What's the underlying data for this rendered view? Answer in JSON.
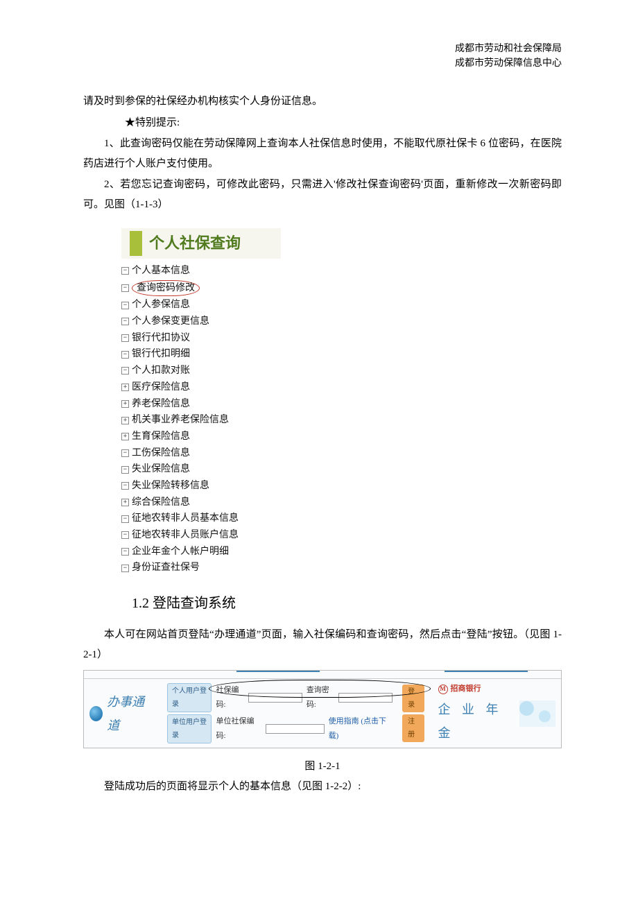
{
  "header": {
    "line1": "成都市劳动和社会保障局",
    "line2": "成都市劳动保障信息中心"
  },
  "body": {
    "p0": "请及时到参保的社保经办机构核实个人身份证信息。",
    "p1": "★特别提示:",
    "p2": "1、此查询密码仅能在劳动保障网上查询本人社保信息时使用，不能取代原社保卡 6 位密码，在医院药店进行个人账户支付使用。",
    "p3": "2、若您忘记查询密码，可修改此密码，只需进入'修改社保查询密码'页面，重新修改一次新密码即可。见图（1-1-3）"
  },
  "menu": {
    "title": "个人社保查询",
    "items": [
      {
        "icon": "-",
        "label": "个人基本信息"
      },
      {
        "icon": "-",
        "label": "查询密码修改",
        "highlight": true
      },
      {
        "icon": "-",
        "label": "个人参保信息"
      },
      {
        "icon": "-",
        "label": "个人参保变更信息"
      },
      {
        "icon": "-",
        "label": "银行代扣协议"
      },
      {
        "icon": "-",
        "label": "银行代扣明细"
      },
      {
        "icon": "-",
        "label": "个人扣款对账"
      },
      {
        "icon": "+",
        "label": "医疗保险信息"
      },
      {
        "icon": "+",
        "label": "养老保险信息"
      },
      {
        "icon": "+",
        "label": "机关事业养老保险信息"
      },
      {
        "icon": "+",
        "label": "生育保险信息"
      },
      {
        "icon": "-",
        "label": "工伤保险信息"
      },
      {
        "icon": "-",
        "label": "失业保险信息"
      },
      {
        "icon": "-",
        "label": "失业保险转移信息"
      },
      {
        "icon": "+",
        "label": "综合保险信息"
      },
      {
        "icon": "-",
        "label": "征地农转非人员基本信息"
      },
      {
        "icon": "-",
        "label": "征地农转非人员账户信息"
      },
      {
        "icon": "-",
        "label": "企业年金个人帐户明细"
      },
      {
        "icon": "-",
        "label": "身份证查社保号"
      }
    ]
  },
  "section": {
    "heading": "1.2 登陆查询系统",
    "p1": "本人可在网站首页登陆“办理通道”页面，输入社保编码和查询密码，然后点击“登陆”按钮。（见图 1-2-1）",
    "caption": "图 1-2-1",
    "p2": "登陆成功后的页面将显示个人的基本信息（见图 1-2-2）:"
  },
  "loginbar": {
    "brand": "办事通道",
    "tab_personal": "个人用户登录",
    "tab_unit": "单位用户登录",
    "label_ssn": "社保编码:",
    "label_pwd": "查询密码:",
    "label_unit_ssn": "单位社保编码:",
    "guide": "使用指南 (点击下载)",
    "btn_login": "登录",
    "btn_register": "注册",
    "bank": "招商银行",
    "pension": "企 业 年 金"
  }
}
